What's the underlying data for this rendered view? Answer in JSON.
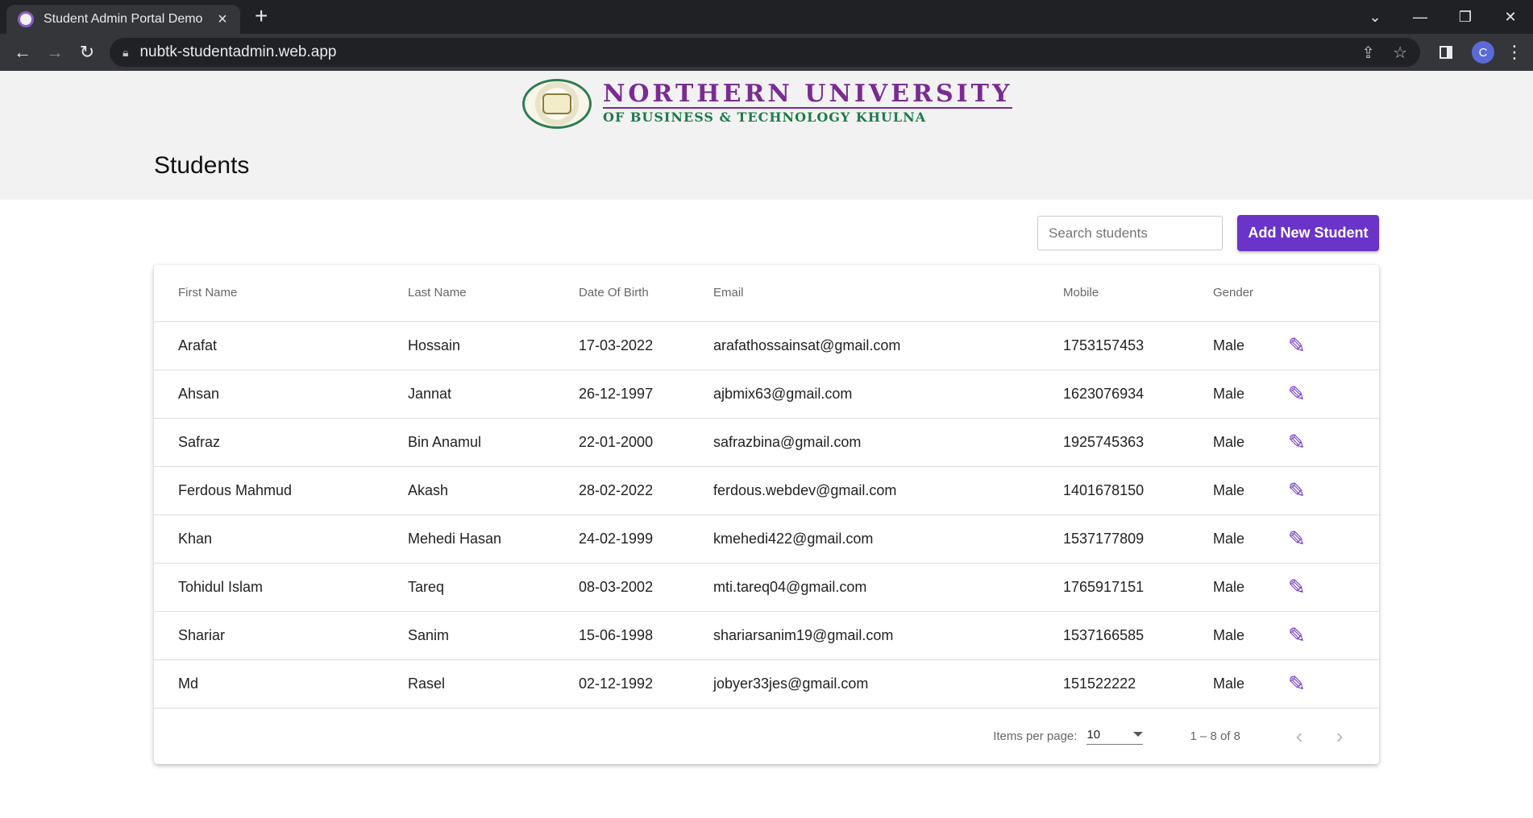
{
  "browser": {
    "tab_title": "Student Admin Portal Demo",
    "close_icon": "×",
    "new_tab_icon": "+",
    "url": "nubtk-studentadmin.web.app",
    "profile_initial": "C"
  },
  "header": {
    "logo_line1": "NORTHERN UNIVERSITY",
    "logo_line2": "OF BUSINESS & TECHNOLOGY KHULNA",
    "title": "Students"
  },
  "actions": {
    "search_placeholder": "Search students",
    "add_label": "Add New Student"
  },
  "table": {
    "columns": [
      "First Name",
      "Last Name",
      "Date Of Birth",
      "Email",
      "Mobile",
      "Gender"
    ],
    "rows": [
      [
        "Arafat",
        "Hossain",
        "17-03-2022",
        "arafathossainsat@gmail.com",
        "1753157453",
        "Male"
      ],
      [
        "Ahsan",
        "Jannat",
        "26-12-1997",
        "ajbmix63@gmail.com",
        "1623076934",
        "Male"
      ],
      [
        "Safraz",
        "Bin Anamul",
        "22-01-2000",
        "safrazbina@gmail.com",
        "1925745363",
        "Male"
      ],
      [
        "Ferdous Mahmud",
        "Akash",
        "28-02-2022",
        "ferdous.webdev@gmail.com",
        "1401678150",
        "Male"
      ],
      [
        "Khan",
        "Mehedi Hasan",
        "24-02-1999",
        "kmehedi422@gmail.com",
        "1537177809",
        "Male"
      ],
      [
        "Tohidul Islam",
        "Tareq",
        "08-03-2002",
        "mti.tareq04@gmail.com",
        "1765917151",
        "Male"
      ],
      [
        "Shariar",
        "Sanim",
        "15-06-1998",
        "shariarsanim19@gmail.com",
        "1537166585",
        "Male"
      ],
      [
        "Md",
        "Rasel",
        "02-12-1992",
        "jobyer33jes@gmail.com",
        "151522222",
        "Male"
      ]
    ]
  },
  "paginator": {
    "items_per_page_label": "Items per page:",
    "items_per_page": "10",
    "range": "1 – 8 of 8"
  },
  "colors": {
    "accent": "#6b34c8",
    "logo_purple": "#7a2b92",
    "logo_green": "#1f7a4d"
  },
  "icons": {
    "edit": "pencil-icon",
    "prev": "chevron-left-icon",
    "next": "chevron-right-icon"
  }
}
